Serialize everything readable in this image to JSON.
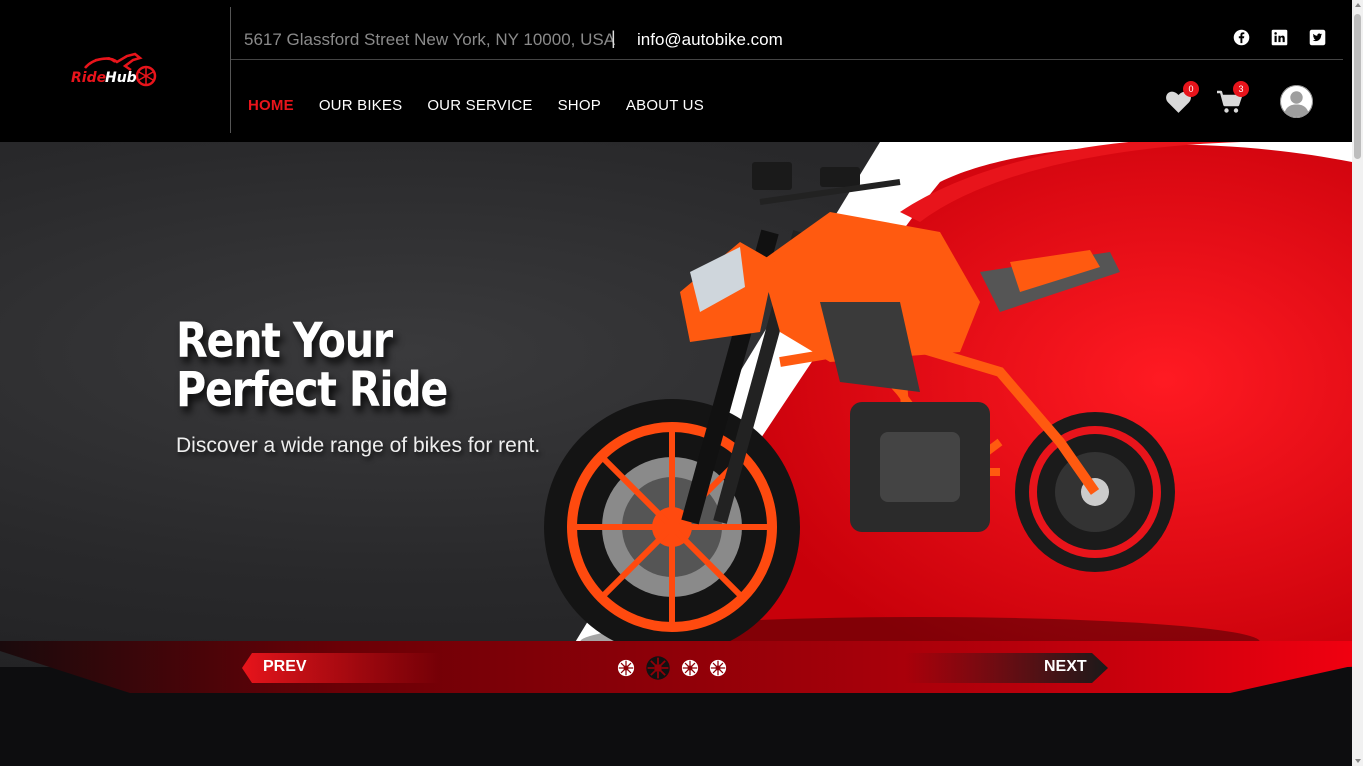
{
  "brand": {
    "name": "RideHub",
    "accent": "#e8141b"
  },
  "topbar": {
    "address": "5617 Glassford Street New York, NY 10000, USA",
    "separator": "|",
    "email": "info@autobike.com",
    "social": [
      "facebook-icon",
      "linkedin-icon",
      "twitter-icon"
    ]
  },
  "nav": {
    "items": [
      {
        "label": "HOME",
        "active": true
      },
      {
        "label": "OUR BIKES",
        "active": false
      },
      {
        "label": "OUR SERVICE",
        "active": false
      },
      {
        "label": "SHOP",
        "active": false
      },
      {
        "label": "ABOUT US",
        "active": false
      }
    ]
  },
  "header_icons": {
    "wishlist_count": "0",
    "cart_count": "3"
  },
  "hero": {
    "title_line1": "Rent Your",
    "title_line2": "Perfect Ride",
    "subtitle": "Discover a wide range of bikes for rent."
  },
  "slider": {
    "prev_label": "PREV",
    "next_label": "NEXT",
    "slide_count": 4,
    "active_index": 1
  }
}
